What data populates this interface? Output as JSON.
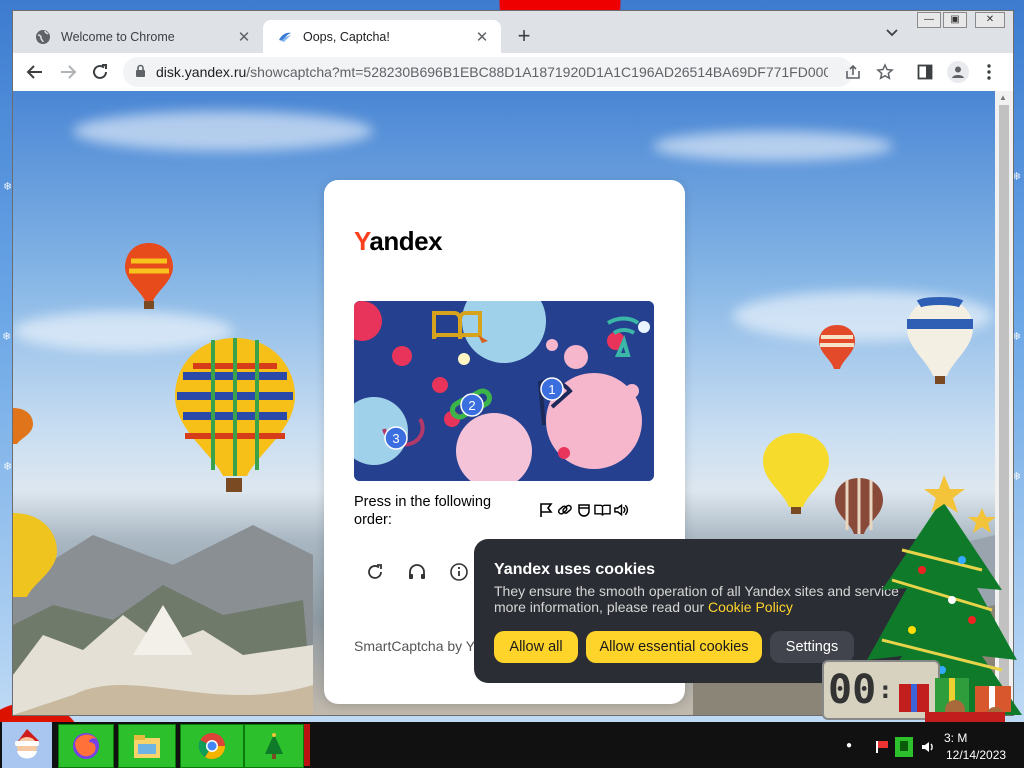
{
  "browser": {
    "tabs": [
      {
        "title": "Welcome to Chrome",
        "active": false
      },
      {
        "title": "Oops, Captcha!",
        "active": true
      }
    ],
    "new_tab_icon": "plus-icon",
    "window_controls": [
      "minimize",
      "maximize",
      "close"
    ],
    "address_bar": {
      "domain": "disk.yandex.ru",
      "path": "/showcaptcha?mt=528230B696B1EBC88D1A1871920D1A1C196AD26514BA69DF771FD000D..."
    }
  },
  "captcha": {
    "logo_first": "Y",
    "logo_rest": "andex",
    "challenge_markers": [
      "1",
      "2",
      "3"
    ],
    "instruction": "Press in the following order:",
    "order_icons": [
      "flag-icon",
      "link-icon",
      "cup-icon",
      "book-icon",
      "speaker-icon"
    ],
    "controls": [
      "refresh-icon",
      "audio-icon",
      "info-icon"
    ],
    "brand": "SmartCaptcha by Y"
  },
  "cookie_banner": {
    "title": "Yandex uses cookies",
    "text_line1": "They ensure the smooth operation of all Yandex sites and service",
    "text_line2_prefix": "more information, please read our ",
    "policy_link": "Cookie Policy",
    "buttons": {
      "allow_all": "Allow all",
      "allow_essential": "Allow essential cookies",
      "settings": "Settings"
    }
  },
  "desktop": {
    "clock_gadget": "00",
    "taskbar": {
      "time": "3:  M",
      "date": "12/14/2023"
    }
  }
}
